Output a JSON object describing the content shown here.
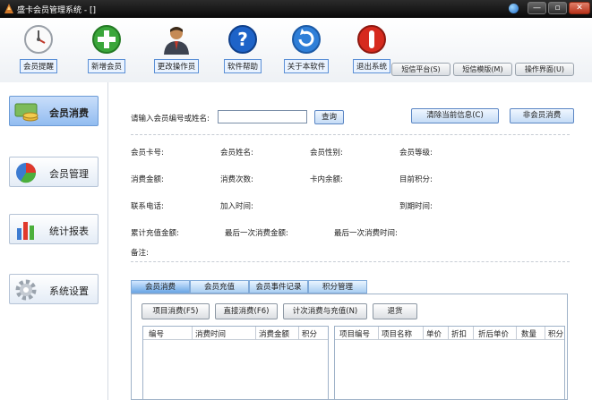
{
  "window": {
    "title": "盛卡会员管理系统 - []",
    "minimize": "—",
    "maximize": "▫",
    "close": "✕"
  },
  "toolbar": {
    "items": [
      {
        "label": "会员提醒",
        "icon": "clock-icon"
      },
      {
        "label": "新增会员",
        "icon": "plus-circle-icon"
      },
      {
        "label": "更改操作员",
        "icon": "user-icon"
      },
      {
        "label": "软件帮助",
        "icon": "help-icon"
      },
      {
        "label": "关于本软件",
        "icon": "refresh-icon"
      },
      {
        "label": "退出系统",
        "icon": "power-icon"
      }
    ],
    "buttons": [
      "短信平台(S)",
      "短信模版(M)",
      "操作界面(U)"
    ]
  },
  "sidebar": {
    "items": [
      {
        "label": "会员消费",
        "icon": "money-icon",
        "active": true
      },
      {
        "label": "会员管理",
        "icon": "pie-chart-icon",
        "active": false
      },
      {
        "label": "统计报表",
        "icon": "bar-chart-icon",
        "active": false
      },
      {
        "label": "系统设置",
        "icon": "gear-icon",
        "active": false
      }
    ]
  },
  "search": {
    "label": "请输入会员编号或姓名:",
    "value": "",
    "query_button": "查询",
    "clear_button": "清除当前信息(C)",
    "nonmember_button": "非会员消费"
  },
  "info": {
    "card_no": "会员卡号:",
    "name": "会员姓名:",
    "gender": "会员性别:",
    "level": "会员等级:",
    "amount": "消费金额:",
    "count": "消费次数:",
    "balance": "卡内余额:",
    "points": "目前积分:",
    "phone": "联系电话:",
    "join_time": "加入时间:",
    "expire_time": "到期时间:",
    "recharge_total": "累计充值金额:",
    "last_amount": "最后一次消费金额:",
    "last_time": "最后一次消费时间:",
    "remark": "备注:"
  },
  "tabs": [
    "会员消费",
    "会员充值",
    "会员事件记录",
    "积分管理"
  ],
  "actions": [
    "项目消费(F5)",
    "直接消费(F6)",
    "计次消费与充值(N)",
    "退货"
  ],
  "left_grid": {
    "columns": [
      "编号",
      "消费时间",
      "消费金额",
      "积分"
    ]
  },
  "right_grid": {
    "columns": [
      "项目编号",
      "项目名称",
      "单价",
      "折扣",
      "折后单价",
      "数量",
      "积分"
    ]
  },
  "colors": {
    "accent": "#5b86c4",
    "titlebar": "#1a1a1a",
    "active_nav": "#92bcf0"
  }
}
